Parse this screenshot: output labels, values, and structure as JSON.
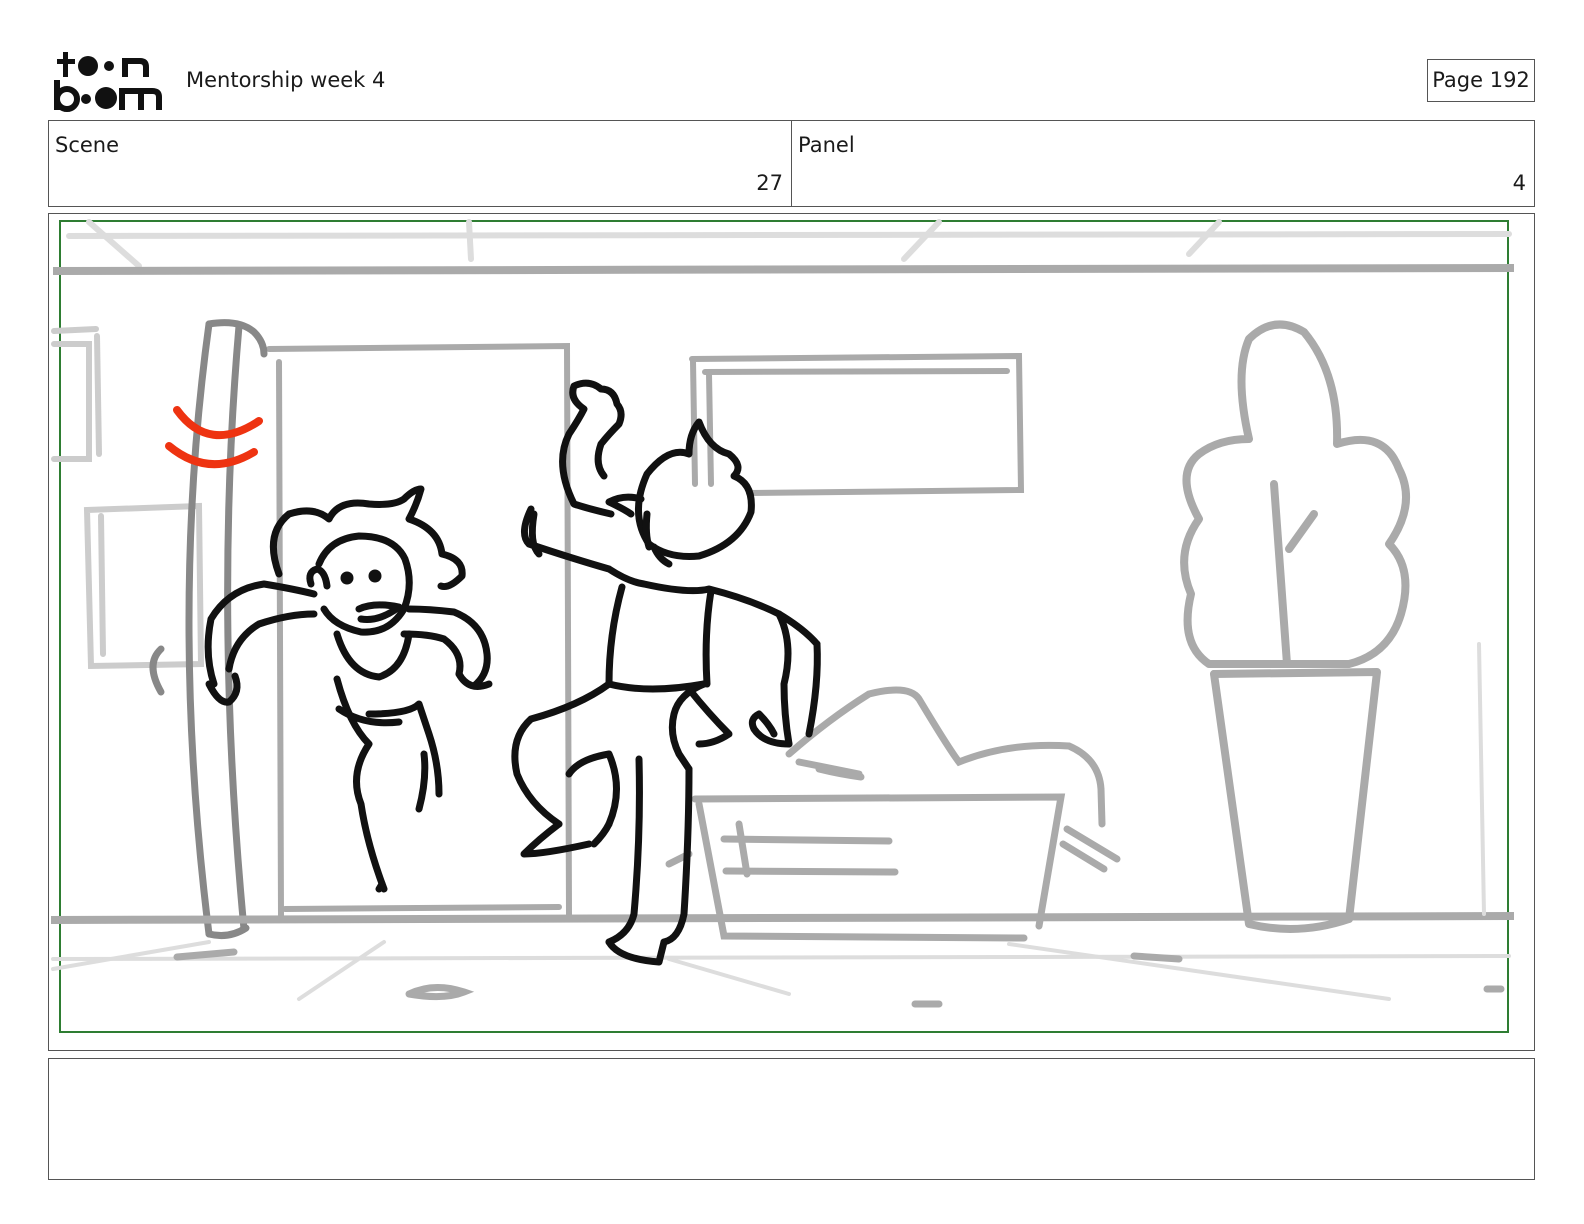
{
  "header": {
    "logo_text_top": "toon",
    "logo_text_bottom": "boom",
    "title": "Mentorship week 4",
    "page_label": "Page 192"
  },
  "info": {
    "scene_label": "Scene",
    "scene_value": "27",
    "panel_label": "Panel",
    "panel_value": "4"
  },
  "notes": {
    "text": ""
  },
  "colors": {
    "frame_border": "#555555",
    "safe_area": "#2e7d32",
    "background_sketch": "#aaaaaa",
    "character_ink": "#111111",
    "accent_red": "#ee3311"
  }
}
